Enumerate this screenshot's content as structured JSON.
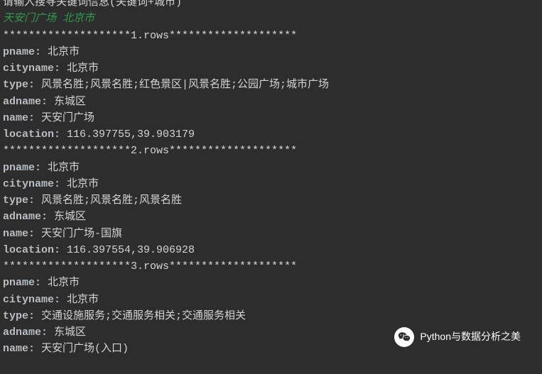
{
  "header": {
    "cut_line": "",
    "prompt": "请输入搜寻关键词信息(关键词+城市)",
    "user_input": "天安门广场 北京市"
  },
  "rows": [
    {
      "header": "********************1.rows********************",
      "pname": "北京市",
      "cityname": "北京市",
      "type": "风景名胜;风景名胜;红色景区|风景名胜;公园广场;城市广场",
      "adname": "东城区",
      "name": "天安门广场",
      "location": "116.397755,39.903179"
    },
    {
      "header": "********************2.rows********************",
      "pname": "北京市",
      "cityname": "北京市",
      "type": "风景名胜;风景名胜;风景名胜",
      "adname": "东城区",
      "name": "天安门广场-国旗",
      "location": "116.397554,39.906928"
    },
    {
      "header": "********************3.rows********************",
      "pname": "北京市",
      "cityname": "北京市",
      "type": "交通设施服务;交通服务相关;交通服务相关",
      "adname": "东城区",
      "name": "天安门广场(入口)"
    }
  ],
  "labels": {
    "pname": "pname:",
    "cityname": "cityname:",
    "type": "type:",
    "adname": "adname:",
    "name": "name:",
    "location": "location:"
  },
  "watermark": {
    "text": "Python与数据分析之美"
  }
}
